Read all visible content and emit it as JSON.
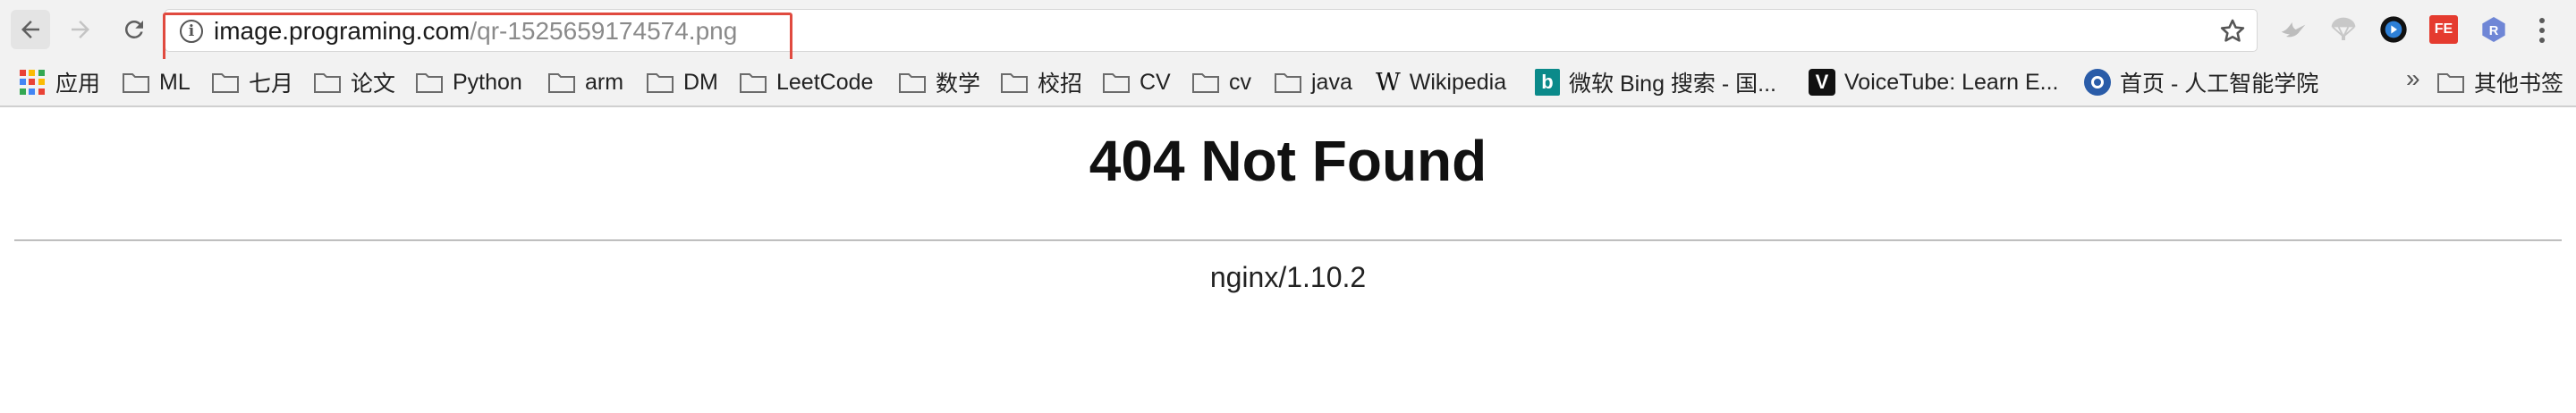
{
  "toolbar": {
    "url_host": "image.programing.com",
    "url_path": "/qr-1525659174574.png",
    "info_icon": "i",
    "nav_icons": [
      "back-arrow-icon",
      "forward-arrow-icon",
      "reload-icon"
    ],
    "extensions": [
      "bird-icon",
      "parachute-icon",
      "media-play-icon",
      "fe-extension-icon",
      "r-extension-icon"
    ],
    "fe_label": "FE",
    "r_label": "R",
    "highlight_color": "#e04a3f"
  },
  "bookmarks": {
    "apps": "应用",
    "items": [
      "ML",
      "七月",
      "论文",
      "Python",
      "arm",
      "DM",
      "LeetCode",
      "数学",
      "校招",
      "CV",
      "cv",
      "java"
    ],
    "wikipedia": "Wikipedia",
    "wiki_icon": "W",
    "bing": "微软 Bing 搜索 - 国...",
    "bing_icon": "b",
    "voicetube": "VoiceTube: Learn E...",
    "voicetube_icon": "V",
    "ai_home": "首页 - 人工智能学院",
    "overflow": "»",
    "other": "其他书签"
  },
  "page": {
    "title": "404 Not Found",
    "server": "nginx/1.10.2"
  }
}
